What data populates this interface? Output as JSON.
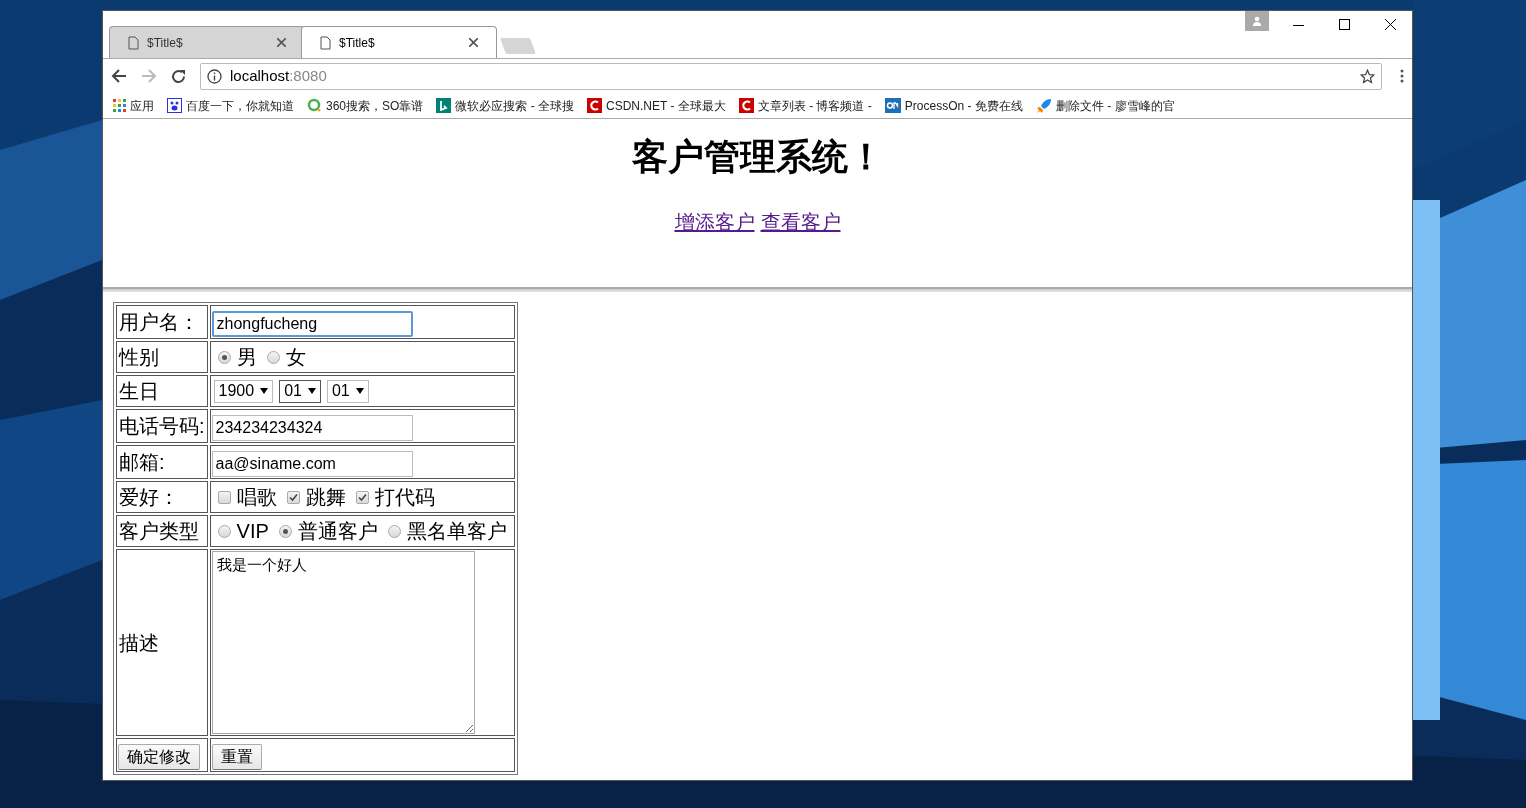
{
  "tabs": [
    {
      "title": "$Title$",
      "selected": false
    },
    {
      "title": "$Title$",
      "selected": true
    }
  ],
  "address": {
    "host": "localhost",
    "port": ":8080"
  },
  "bookmarks": [
    {
      "label": "应用",
      "kind": "apps"
    },
    {
      "label": "百度一下，你就知道",
      "kind": "paw"
    },
    {
      "label": "360搜索，SO靠谱",
      "kind": "ring"
    },
    {
      "label": "微软必应搜索 - 全球搜",
      "kind": "bing"
    },
    {
      "label": "CSDN.NET - 全球最大",
      "kind": "csdn"
    },
    {
      "label": "文章列表 - 博客频道 -",
      "kind": "csdn"
    },
    {
      "label": "ProcessOn - 免费在线",
      "kind": "on"
    },
    {
      "label": "删除文件 - 廖雪峰的官",
      "kind": "rocket"
    }
  ],
  "page": {
    "heading": "客户管理系统！",
    "links": [
      "增添客户",
      "查看客户"
    ]
  },
  "form": [
    {
      "label": "用户名：",
      "kind": "text",
      "value": "zhongfucheng",
      "focused": true
    },
    {
      "label": "性别",
      "kind": "radio",
      "options": [
        {
          "label": "男",
          "selected": true
        },
        {
          "label": "女",
          "selected": false
        }
      ]
    },
    {
      "label": "生日",
      "kind": "select",
      "values": [
        "1900",
        "01",
        "01"
      ]
    },
    {
      "label": "电话号码:",
      "kind": "text",
      "value": "234234234324",
      "focused": false
    },
    {
      "label": "邮箱:",
      "kind": "text",
      "value": "aa@siname.com",
      "focused": false
    },
    {
      "label": "爱好：",
      "kind": "checkbox",
      "options": [
        {
          "label": "唱歌",
          "checked": false
        },
        {
          "label": "跳舞",
          "checked": true
        },
        {
          "label": "打代码",
          "checked": true
        }
      ]
    },
    {
      "label": "客户类型",
      "kind": "radio",
      "options": [
        {
          "label": "VIP",
          "selected": false
        },
        {
          "label": "普通客户",
          "selected": true
        },
        {
          "label": "黑名单客户",
          "selected": false
        }
      ]
    },
    {
      "label": "描述",
      "kind": "textarea",
      "value": "我是一个好人"
    },
    {
      "kind": "buttons",
      "buttons": [
        "确定修改",
        "重置"
      ]
    }
  ]
}
